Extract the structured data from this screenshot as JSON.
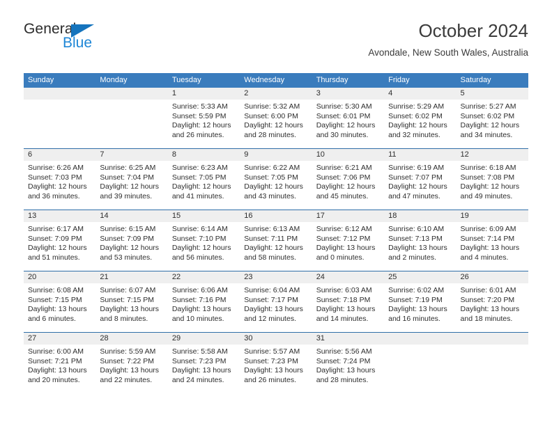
{
  "brand": {
    "name_part1": "General",
    "name_part2": "Blue",
    "triangle_icon": "triangle-icon",
    "color_dark": "#2b2b2b",
    "color_blue": "#1d86d6"
  },
  "header": {
    "title": "October 2024",
    "subtitle": "Avondale, New South Wales, Australia"
  },
  "theme": {
    "header_blue": "#3a7cbd",
    "rule_blue": "#2f6ea8",
    "band_gray": "#efefef"
  },
  "calendar": {
    "weekdays": [
      "Sunday",
      "Monday",
      "Tuesday",
      "Wednesday",
      "Thursday",
      "Friday",
      "Saturday"
    ],
    "weeks": [
      [
        {
          "day": "",
          "sunrise": "",
          "sunset": "",
          "daylight1": "",
          "daylight2": ""
        },
        {
          "day": "",
          "sunrise": "",
          "sunset": "",
          "daylight1": "",
          "daylight2": ""
        },
        {
          "day": "1",
          "sunrise": "Sunrise: 5:33 AM",
          "sunset": "Sunset: 5:59 PM",
          "daylight1": "Daylight: 12 hours",
          "daylight2": "and 26 minutes."
        },
        {
          "day": "2",
          "sunrise": "Sunrise: 5:32 AM",
          "sunset": "Sunset: 6:00 PM",
          "daylight1": "Daylight: 12 hours",
          "daylight2": "and 28 minutes."
        },
        {
          "day": "3",
          "sunrise": "Sunrise: 5:30 AM",
          "sunset": "Sunset: 6:01 PM",
          "daylight1": "Daylight: 12 hours",
          "daylight2": "and 30 minutes."
        },
        {
          "day": "4",
          "sunrise": "Sunrise: 5:29 AM",
          "sunset": "Sunset: 6:02 PM",
          "daylight1": "Daylight: 12 hours",
          "daylight2": "and 32 minutes."
        },
        {
          "day": "5",
          "sunrise": "Sunrise: 5:27 AM",
          "sunset": "Sunset: 6:02 PM",
          "daylight1": "Daylight: 12 hours",
          "daylight2": "and 34 minutes."
        }
      ],
      [
        {
          "day": "6",
          "sunrise": "Sunrise: 6:26 AM",
          "sunset": "Sunset: 7:03 PM",
          "daylight1": "Daylight: 12 hours",
          "daylight2": "and 36 minutes."
        },
        {
          "day": "7",
          "sunrise": "Sunrise: 6:25 AM",
          "sunset": "Sunset: 7:04 PM",
          "daylight1": "Daylight: 12 hours",
          "daylight2": "and 39 minutes."
        },
        {
          "day": "8",
          "sunrise": "Sunrise: 6:23 AM",
          "sunset": "Sunset: 7:05 PM",
          "daylight1": "Daylight: 12 hours",
          "daylight2": "and 41 minutes."
        },
        {
          "day": "9",
          "sunrise": "Sunrise: 6:22 AM",
          "sunset": "Sunset: 7:05 PM",
          "daylight1": "Daylight: 12 hours",
          "daylight2": "and 43 minutes."
        },
        {
          "day": "10",
          "sunrise": "Sunrise: 6:21 AM",
          "sunset": "Sunset: 7:06 PM",
          "daylight1": "Daylight: 12 hours",
          "daylight2": "and 45 minutes."
        },
        {
          "day": "11",
          "sunrise": "Sunrise: 6:19 AM",
          "sunset": "Sunset: 7:07 PM",
          "daylight1": "Daylight: 12 hours",
          "daylight2": "and 47 minutes."
        },
        {
          "day": "12",
          "sunrise": "Sunrise: 6:18 AM",
          "sunset": "Sunset: 7:08 PM",
          "daylight1": "Daylight: 12 hours",
          "daylight2": "and 49 minutes."
        }
      ],
      [
        {
          "day": "13",
          "sunrise": "Sunrise: 6:17 AM",
          "sunset": "Sunset: 7:09 PM",
          "daylight1": "Daylight: 12 hours",
          "daylight2": "and 51 minutes."
        },
        {
          "day": "14",
          "sunrise": "Sunrise: 6:15 AM",
          "sunset": "Sunset: 7:09 PM",
          "daylight1": "Daylight: 12 hours",
          "daylight2": "and 53 minutes."
        },
        {
          "day": "15",
          "sunrise": "Sunrise: 6:14 AM",
          "sunset": "Sunset: 7:10 PM",
          "daylight1": "Daylight: 12 hours",
          "daylight2": "and 56 minutes."
        },
        {
          "day": "16",
          "sunrise": "Sunrise: 6:13 AM",
          "sunset": "Sunset: 7:11 PM",
          "daylight1": "Daylight: 12 hours",
          "daylight2": "and 58 minutes."
        },
        {
          "day": "17",
          "sunrise": "Sunrise: 6:12 AM",
          "sunset": "Sunset: 7:12 PM",
          "daylight1": "Daylight: 13 hours",
          "daylight2": "and 0 minutes."
        },
        {
          "day": "18",
          "sunrise": "Sunrise: 6:10 AM",
          "sunset": "Sunset: 7:13 PM",
          "daylight1": "Daylight: 13 hours",
          "daylight2": "and 2 minutes."
        },
        {
          "day": "19",
          "sunrise": "Sunrise: 6:09 AM",
          "sunset": "Sunset: 7:14 PM",
          "daylight1": "Daylight: 13 hours",
          "daylight2": "and 4 minutes."
        }
      ],
      [
        {
          "day": "20",
          "sunrise": "Sunrise: 6:08 AM",
          "sunset": "Sunset: 7:15 PM",
          "daylight1": "Daylight: 13 hours",
          "daylight2": "and 6 minutes."
        },
        {
          "day": "21",
          "sunrise": "Sunrise: 6:07 AM",
          "sunset": "Sunset: 7:15 PM",
          "daylight1": "Daylight: 13 hours",
          "daylight2": "and 8 minutes."
        },
        {
          "day": "22",
          "sunrise": "Sunrise: 6:06 AM",
          "sunset": "Sunset: 7:16 PM",
          "daylight1": "Daylight: 13 hours",
          "daylight2": "and 10 minutes."
        },
        {
          "day": "23",
          "sunrise": "Sunrise: 6:04 AM",
          "sunset": "Sunset: 7:17 PM",
          "daylight1": "Daylight: 13 hours",
          "daylight2": "and 12 minutes."
        },
        {
          "day": "24",
          "sunrise": "Sunrise: 6:03 AM",
          "sunset": "Sunset: 7:18 PM",
          "daylight1": "Daylight: 13 hours",
          "daylight2": "and 14 minutes."
        },
        {
          "day": "25",
          "sunrise": "Sunrise: 6:02 AM",
          "sunset": "Sunset: 7:19 PM",
          "daylight1": "Daylight: 13 hours",
          "daylight2": "and 16 minutes."
        },
        {
          "day": "26",
          "sunrise": "Sunrise: 6:01 AM",
          "sunset": "Sunset: 7:20 PM",
          "daylight1": "Daylight: 13 hours",
          "daylight2": "and 18 minutes."
        }
      ],
      [
        {
          "day": "27",
          "sunrise": "Sunrise: 6:00 AM",
          "sunset": "Sunset: 7:21 PM",
          "daylight1": "Daylight: 13 hours",
          "daylight2": "and 20 minutes."
        },
        {
          "day": "28",
          "sunrise": "Sunrise: 5:59 AM",
          "sunset": "Sunset: 7:22 PM",
          "daylight1": "Daylight: 13 hours",
          "daylight2": "and 22 minutes."
        },
        {
          "day": "29",
          "sunrise": "Sunrise: 5:58 AM",
          "sunset": "Sunset: 7:23 PM",
          "daylight1": "Daylight: 13 hours",
          "daylight2": "and 24 minutes."
        },
        {
          "day": "30",
          "sunrise": "Sunrise: 5:57 AM",
          "sunset": "Sunset: 7:23 PM",
          "daylight1": "Daylight: 13 hours",
          "daylight2": "and 26 minutes."
        },
        {
          "day": "31",
          "sunrise": "Sunrise: 5:56 AM",
          "sunset": "Sunset: 7:24 PM",
          "daylight1": "Daylight: 13 hours",
          "daylight2": "and 28 minutes."
        },
        {
          "day": "",
          "sunrise": "",
          "sunset": "",
          "daylight1": "",
          "daylight2": ""
        },
        {
          "day": "",
          "sunrise": "",
          "sunset": "",
          "daylight1": "",
          "daylight2": ""
        }
      ]
    ]
  }
}
